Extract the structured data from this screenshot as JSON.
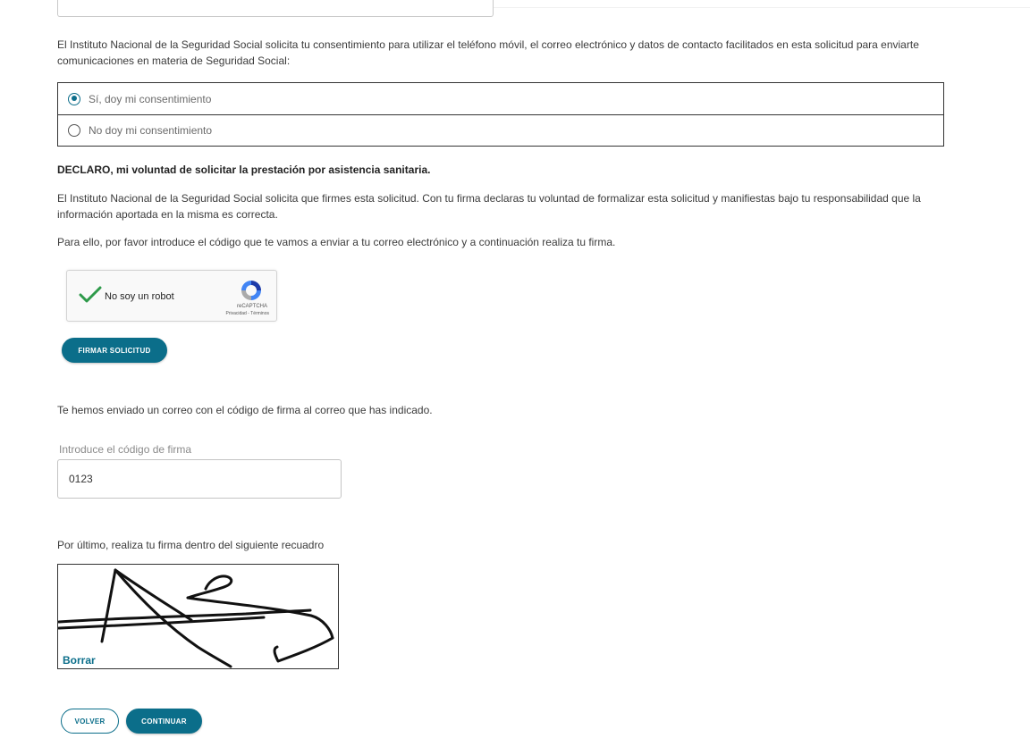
{
  "consent": {
    "intro": "El Instituto Nacional de la Seguridad Social solicita tu consentimiento para utilizar el teléfono móvil, el correo electrónico y datos de contacto facilitados en esta solicitud para enviarte comunicaciones en materia de Seguridad Social:",
    "options": [
      {
        "label": "Sí, doy mi consentimiento",
        "selected": true
      },
      {
        "label": "No doy mi consentimiento",
        "selected": false
      }
    ]
  },
  "declaration": {
    "heading": "DECLARO, mi voluntad de solicitar la prestación por asistencia sanitaria.",
    "body": "El Instituto Nacional de la Seguridad Social solicita que firmes esta solicitud. Con tu firma declaras tu voluntad de formalizar esta solicitud y manifiestas bajo tu responsabilidad que la información aportada en la misma es correcta.",
    "instructions": "Para ello, por favor introduce el código que te vamos a enviar a tu correo electrónico y a continuación realiza tu firma."
  },
  "captcha": {
    "label": "No soy un robot",
    "checked": true,
    "brand": "reCAPTCHA",
    "links": "Privacidad - Términos",
    "check_color": "#2e9a4a"
  },
  "sign_request_button": "FIRMAR SOLICITUD",
  "email_sent_message": "Te hemos enviado un correo con el código de firma al correo que has indicado.",
  "signature_code": {
    "label": "Introduce el código de firma",
    "value": "0123"
  },
  "signature_pad": {
    "prompt": "Por último, realiza tu firma dentro del siguiente recuadro",
    "clear_label": "Borrar"
  },
  "nav": {
    "back_label": "VOLVER",
    "continue_label": "CONTINUAR"
  },
  "colors": {
    "primary": "#0b6e8a",
    "text": "#3b3b3b",
    "muted": "#8a8a8a"
  }
}
